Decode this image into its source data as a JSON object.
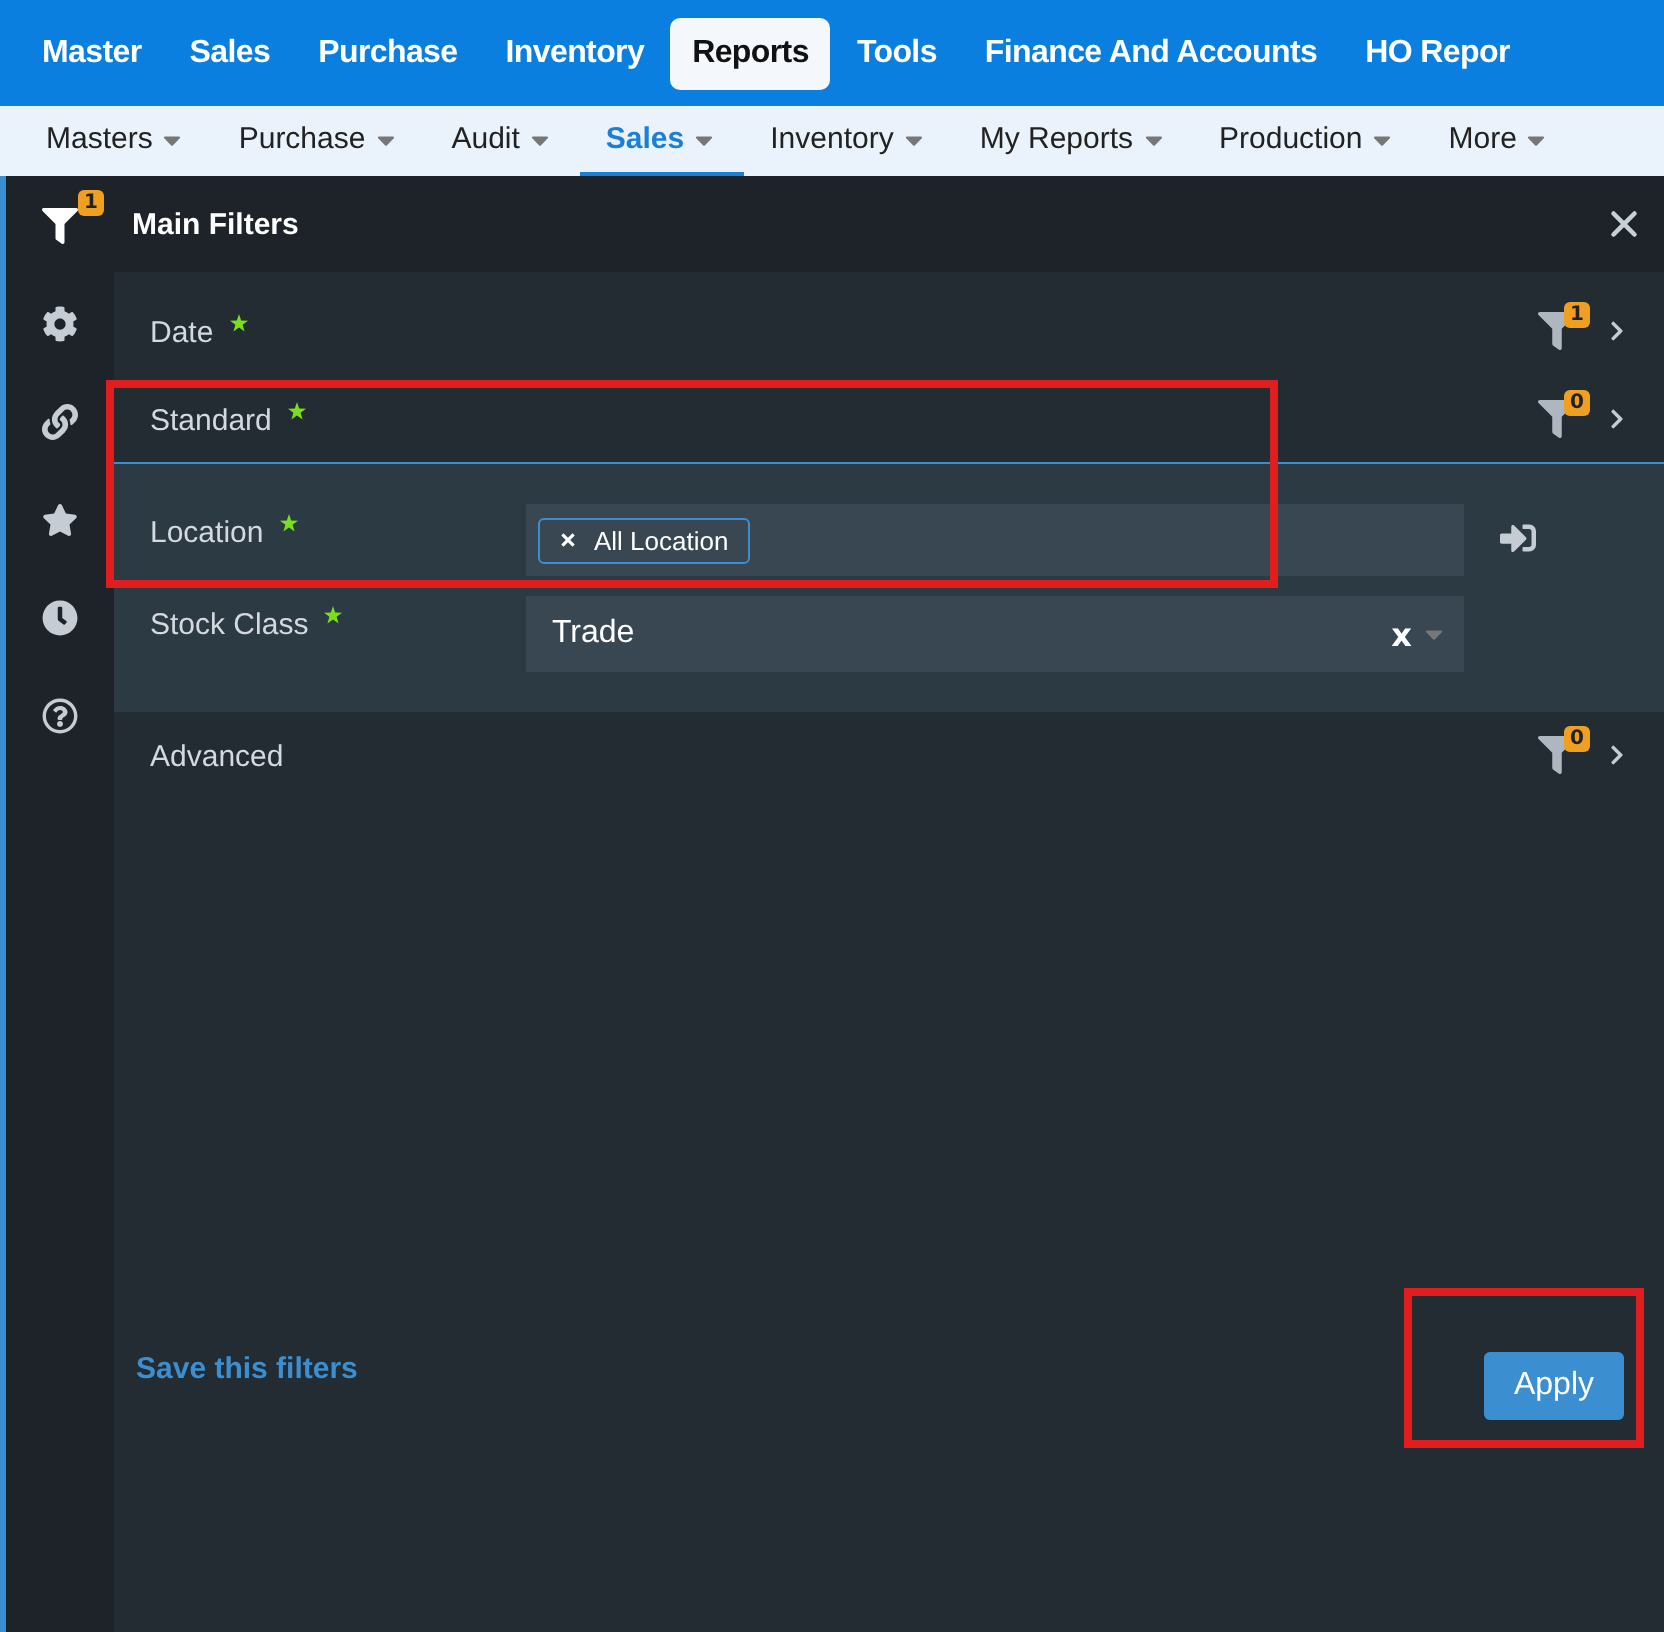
{
  "top_nav": [
    {
      "label": "Master",
      "selected": false
    },
    {
      "label": "Sales",
      "selected": false
    },
    {
      "label": "Purchase",
      "selected": false
    },
    {
      "label": "Inventory",
      "selected": false
    },
    {
      "label": "Reports",
      "selected": true
    },
    {
      "label": "Tools",
      "selected": false
    },
    {
      "label": "Finance And Accounts",
      "selected": false
    },
    {
      "label": "HO Repor",
      "selected": false
    }
  ],
  "sub_nav": [
    {
      "label": "Masters",
      "selected": false
    },
    {
      "label": "Purchase",
      "selected": false
    },
    {
      "label": "Audit",
      "selected": false
    },
    {
      "label": "Sales",
      "selected": true
    },
    {
      "label": "Inventory",
      "selected": false
    },
    {
      "label": "My Reports",
      "selected": false
    },
    {
      "label": "Production",
      "selected": false
    },
    {
      "label": "More",
      "selected": false
    }
  ],
  "rail": [
    {
      "kind": "filter",
      "badge": "1",
      "selected": true
    },
    {
      "kind": "settings",
      "selected": false
    },
    {
      "kind": "link",
      "selected": false
    },
    {
      "kind": "star",
      "selected": false
    },
    {
      "kind": "clock",
      "selected": false
    },
    {
      "kind": "help",
      "selected": false
    }
  ],
  "panel": {
    "title": "Main Filters",
    "sections": [
      {
        "label": "Date",
        "required": true,
        "badge": "1",
        "expanded": false,
        "highlighted": false
      },
      {
        "label": "Standard",
        "required": true,
        "badge": "0",
        "expanded": true,
        "highlighted": true,
        "fields": [
          {
            "kind": "tags",
            "label": "Location",
            "required": true,
            "tags": [
              "All Location"
            ]
          },
          {
            "kind": "select",
            "label": "Stock Class",
            "required": true,
            "value": "Trade",
            "clear": "x"
          }
        ]
      },
      {
        "label": "Advanced",
        "required": false,
        "badge": "0",
        "expanded": false,
        "highlighted": false
      }
    ],
    "save_link": "Save this filters",
    "apply": {
      "label": "Apply",
      "highlighted": true
    }
  }
}
